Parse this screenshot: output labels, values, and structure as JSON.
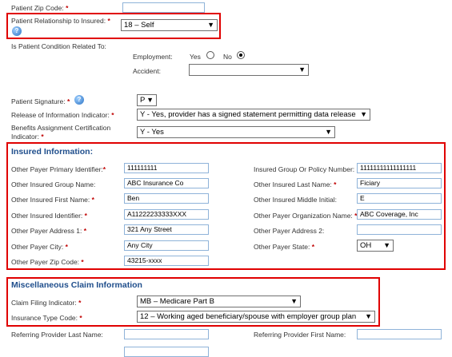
{
  "top": {
    "zip_label": "Patient Zip Code:",
    "relationship_label": "Patient Relationship to Insured:",
    "relationship_value": "18 – Self",
    "condition_label": "Is Patient Condition Related To:",
    "employment_label": "Employment:",
    "yes_label": "Yes",
    "no_label": "No",
    "accident_label": "Accident:",
    "accident_value": "",
    "signature_label": "Patient Signature:",
    "signature_value": "P",
    "release_label": "Release of Information Indicator:",
    "release_value": "Y - Yes, provider has a signed statement permitting data release",
    "benefits_label_1": "Benefits Assignment Certification",
    "benefits_label_2": "Indicator:",
    "benefits_value": "Y - Yes",
    "required_mark": "*"
  },
  "insured": {
    "title": "Insured Information:",
    "left": [
      {
        "label": "Other Payer Primary Identifier:",
        "value": "111111111"
      },
      {
        "label": "Other Insured Group Name:",
        "value": "ABC Insurance Co"
      },
      {
        "label": "Other Insured First Name:",
        "value": "Ben"
      },
      {
        "label": "Other Insured Identifier:",
        "value": "A11222233333XXX"
      },
      {
        "label": "Other Payer Address 1:",
        "value": "321 Any Street"
      },
      {
        "label": "Other Payer City:",
        "value": "Any City"
      },
      {
        "label": "Other Payer Zip Code:",
        "value": "43215-xxxx"
      }
    ],
    "right": [
      {
        "label": "Insured Group Or Policy Number:",
        "value": "11111111111111111"
      },
      {
        "label": "Other Insured Last Name:",
        "value": "Ficiary"
      },
      {
        "label": "Other Insured Middle Initial:",
        "value": "E"
      },
      {
        "label": "Other Payer Organization Name:",
        "value": "ABC Coverage, Inc"
      },
      {
        "label": "Other Payer Address 2:",
        "value": ""
      },
      {
        "label": "Other Payer State:",
        "value": "OH"
      }
    ]
  },
  "misc": {
    "title": "Miscellaneous Claim Information",
    "filing_label": "Claim Filing Indicator:",
    "filing_value": "MB – Medicare Part B",
    "insurance_type_label": "Insurance Type Code:",
    "insurance_type_value": "12 – Working aged beneficiary/spouse with employer group plan"
  },
  "bottom": {
    "ref_last_label": "Referring Provider Last Name:",
    "ref_first_label": "Referring Provider First Name:"
  },
  "icons": {
    "help": "help-icon",
    "dropdown": "chevron-down-icon"
  },
  "colors": {
    "highlight": "#e00000",
    "section_title": "#1f4e8c",
    "required": "#c00000"
  }
}
